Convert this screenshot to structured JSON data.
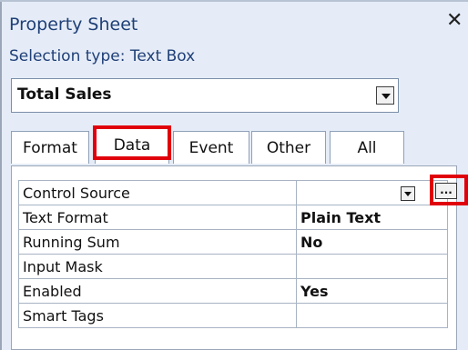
{
  "panel": {
    "title": "Property Sheet",
    "close_symbol": "✕",
    "selection_label": "Selection type:  Text Box"
  },
  "object_combo": {
    "value": "Total Sales",
    "icon": "chevron-down-icon"
  },
  "tabs": [
    {
      "label": "Format",
      "active": false
    },
    {
      "label": "Data",
      "active": true
    },
    {
      "label": "Event",
      "active": false
    },
    {
      "label": "Other",
      "active": false
    },
    {
      "label": "All",
      "active": false
    }
  ],
  "properties": [
    {
      "name": "Control Source",
      "value": ""
    },
    {
      "name": "Text Format",
      "value": "Plain Text"
    },
    {
      "name": "Running Sum",
      "value": "No"
    },
    {
      "name": "Input Mask",
      "value": ""
    },
    {
      "name": "Enabled",
      "value": "Yes"
    },
    {
      "name": "Smart Tags",
      "value": ""
    }
  ],
  "builder_button": {
    "label": "..."
  },
  "colors": {
    "highlight": "#e0000b",
    "panel_bg": "#e5ecf7",
    "title_text": "#1f3f77"
  }
}
